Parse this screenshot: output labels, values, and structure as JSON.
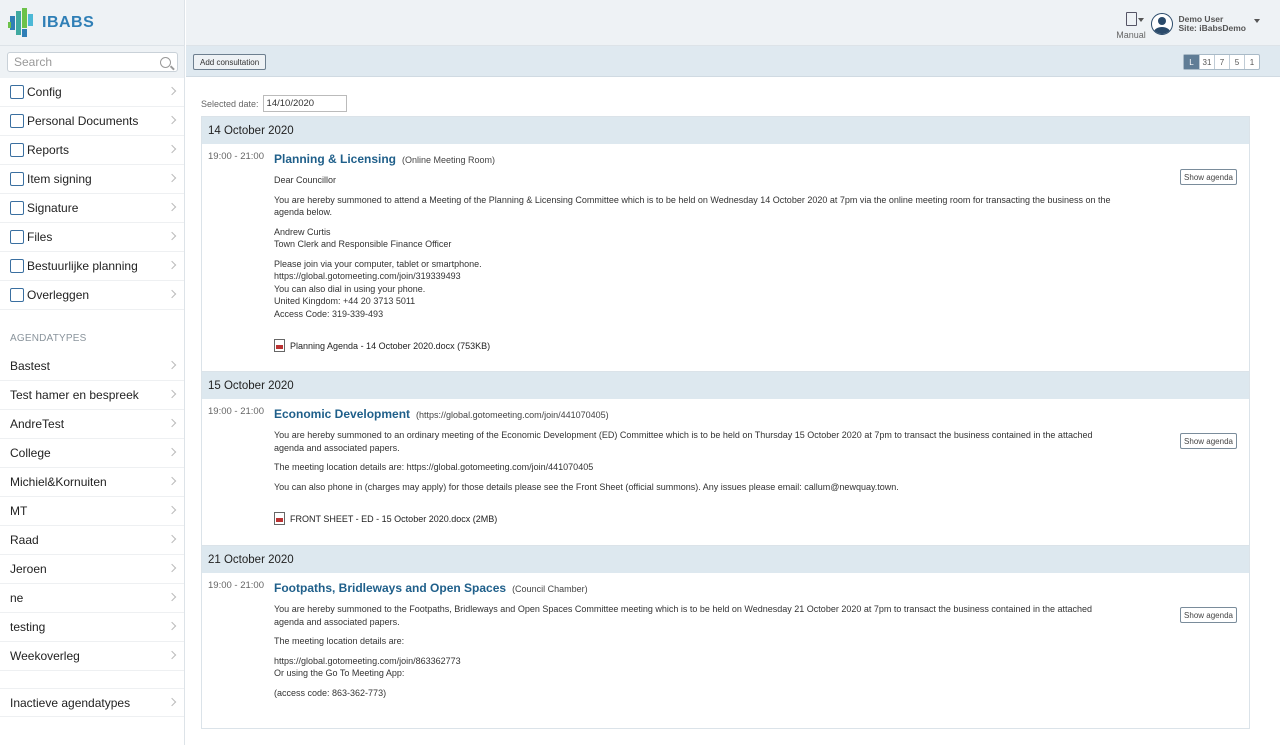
{
  "brand": {
    "name": "IBABS"
  },
  "search": {
    "placeholder": "Search"
  },
  "nav": [
    {
      "label": "Config",
      "icon": "gear-icon"
    },
    {
      "label": "Personal Documents",
      "icon": "folder-icon"
    },
    {
      "label": "Reports",
      "icon": "report-icon"
    },
    {
      "label": "Item signing",
      "icon": "signing-icon"
    },
    {
      "label": "Signature",
      "icon": "signature-icon"
    },
    {
      "label": "Files",
      "icon": "briefcase-icon"
    },
    {
      "label": "Bestuurlijke planning",
      "icon": "calendar-icon"
    },
    {
      "label": "Overleggen",
      "icon": "meeting-icon"
    }
  ],
  "agendatypes": {
    "title": "AGENDATYPES",
    "items": [
      "Bastest",
      "Test hamer en bespreek",
      "AndreTest",
      "College",
      "Michiel&Kornuiten",
      "MT",
      "Raad",
      "Jeroen",
      "ne",
      "testing",
      "Weekoverleg"
    ],
    "inactive": "Inactieve agendatypes"
  },
  "header": {
    "manual": "Manual",
    "user_name": "Demo User",
    "user_site": "Site: iBabsDemo"
  },
  "toolbar": {
    "add_consultation": "Add consultation",
    "views": [
      "L",
      "31",
      "7",
      "5",
      "1"
    ]
  },
  "selected_date": {
    "label": "Selected date:",
    "value": "14/10/2020"
  },
  "days": [
    {
      "date": "14 October 2020",
      "meeting": {
        "time": "19:00 - 21:00",
        "title": "Planning & Licensing",
        "location": "(Online Meeting Room)",
        "show_agenda": "Show agenda",
        "body": [
          "Dear Councillor",
          "You are hereby summoned to attend a Meeting of the Planning & Licensing Committee which is to be held on Wednesday 14 October 2020 at 7pm via the online meeting room for transacting the business on the agenda below.",
          "Andrew Curtis\nTown Clerk and Responsible Finance Officer",
          "Please join via your computer, tablet or smartphone.\nhttps://global.gotomeeting.com/join/319339493\nYou can also dial in using your phone.\nUnited Kingdom: +44 20 3713 5011\nAccess Code: 319-339-493"
        ],
        "attachment": "Planning Agenda - 14 October 2020.docx (753KB)"
      }
    },
    {
      "date": "15 October 2020",
      "meeting": {
        "time": "19:00 - 21:00",
        "title": "Economic Development",
        "location": "(https://global.gotomeeting.com/join/441070405)",
        "show_agenda": "Show agenda",
        "body": [
          "You are hereby summoned to an ordinary meeting of the Economic Development (ED) Committee which is to be held on Thursday 15 October 2020 at 7pm to transact the business contained in the attached agenda and associated papers.",
          "The meeting location details are: https://global.gotomeeting.com/join/441070405",
          "You can also phone in (charges may apply) for those details please see the Front Sheet (official summons). Any issues please email: callum@newquay.town."
        ],
        "attachment": "FRONT SHEET - ED - 15 October 2020.docx (2MB)"
      }
    },
    {
      "date": "21 October 2020",
      "meeting": {
        "time": "19:00 - 21:00",
        "title": "Footpaths, Bridleways and Open Spaces",
        "location": "(Council Chamber)",
        "show_agenda": "Show agenda",
        "body": [
          "You are hereby summoned to the Footpaths, Bridleways and Open Spaces Committee meeting which is to be held on Wednesday 21 October 2020 at 7pm to transact the business contained in the attached agenda and associated papers.",
          "The meeting location details are:",
          "https://global.gotomeeting.com/join/863362773\nOr using the Go To Meeting App:",
          "(access code: 863-362-773)"
        ],
        "attachment": ""
      }
    }
  ]
}
